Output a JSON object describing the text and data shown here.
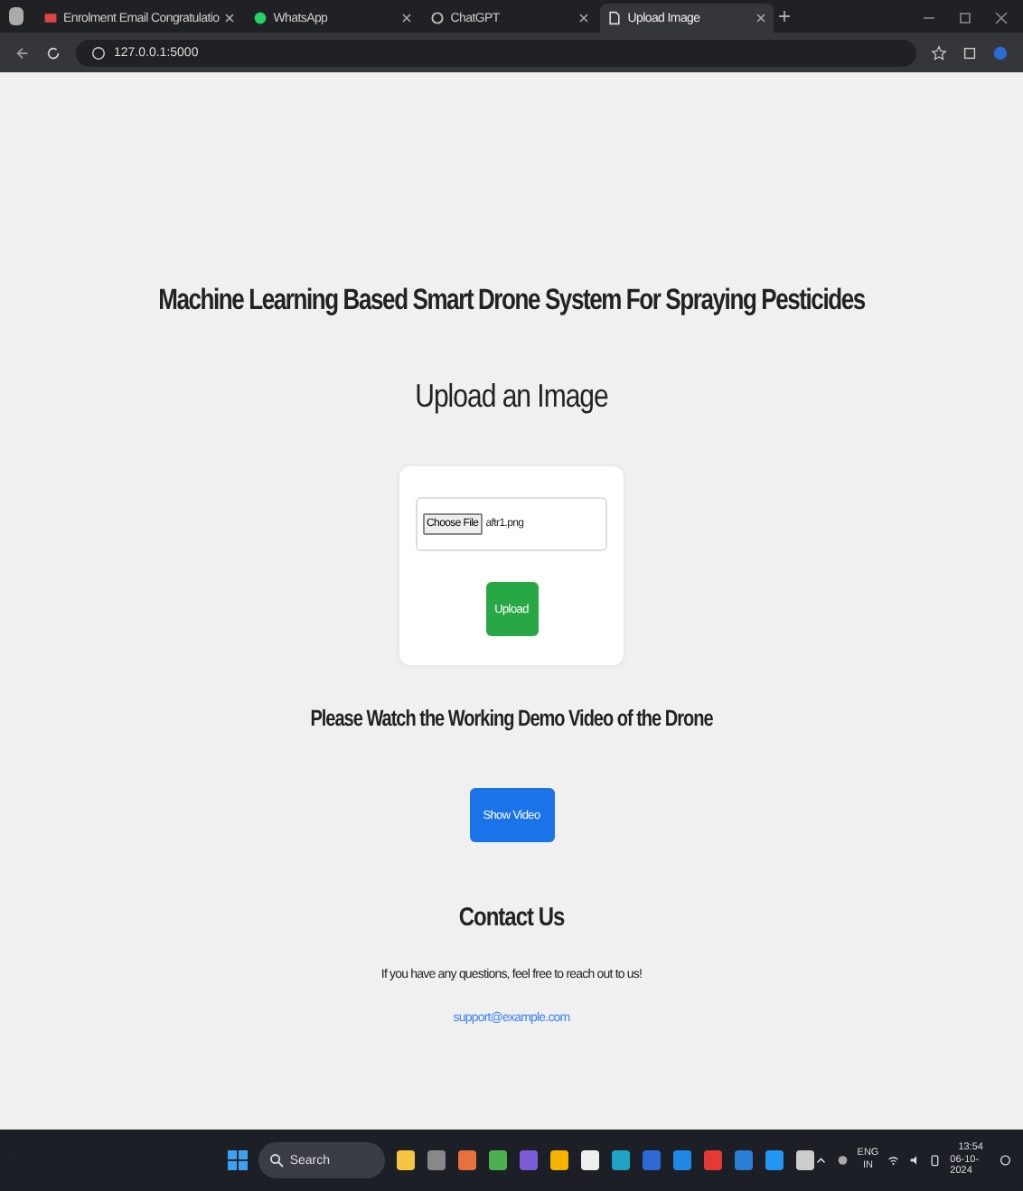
{
  "browser": {
    "tabs": [
      {
        "label": "Enrolment Email Congratulatio",
        "selected": false,
        "kind": "mail"
      },
      {
        "label": "WhatsApp",
        "selected": false,
        "kind": "chat"
      },
      {
        "label": "ChatGPT",
        "selected": false,
        "kind": "ai"
      },
      {
        "label": "Upload Image",
        "selected": true,
        "kind": "page"
      }
    ],
    "address": "127.0.0.1:5000"
  },
  "page": {
    "title": "Machine Learning Based Smart Drone System For Spraying Pesticides",
    "upload_heading": "Upload an Image",
    "file_input": {
      "button": "Choose File",
      "value": "aftr1.png"
    },
    "upload_button": "Upload",
    "video_heading": "Please Watch the Working Demo Video of the Drone",
    "video_button": "Show Video",
    "contact_heading": "Contact Us",
    "contact_text": "If you have any questions, feel free to reach out to us!",
    "contact_email": "support@example.com"
  },
  "taskbar": {
    "search": "Search",
    "language": [
      "ENG",
      "IN"
    ],
    "time": "13:54",
    "date": "06-10-2024"
  }
}
